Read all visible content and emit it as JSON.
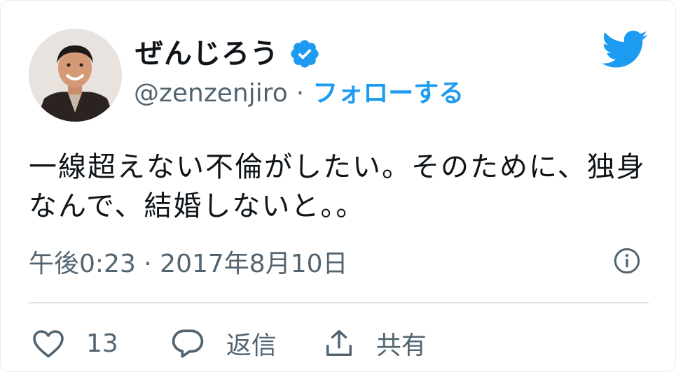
{
  "author": {
    "display_name": "ぜんじろう",
    "handle": "@zenzenjiro",
    "verified": true,
    "separator": "·",
    "follow_label": "フォローする"
  },
  "tweet": {
    "text": "一線超えない不倫がしたい。そのために、独身\nなんで、結婚しないと。。",
    "timestamp": "午後0:23 · 2017年8月10日"
  },
  "actions": {
    "like_count": "13",
    "reply_label": "返信",
    "share_label": "共有"
  },
  "colors": {
    "accent": "#1d9bf0",
    "secondary_text": "#536471",
    "primary_text": "#0f1419",
    "divider": "#dfe5ea"
  },
  "icons": {
    "logo": "twitter-bird-icon",
    "verified": "verified-badge-icon",
    "info": "info-icon",
    "like": "heart-icon",
    "reply": "reply-bubble-icon",
    "share": "share-upload-icon"
  }
}
